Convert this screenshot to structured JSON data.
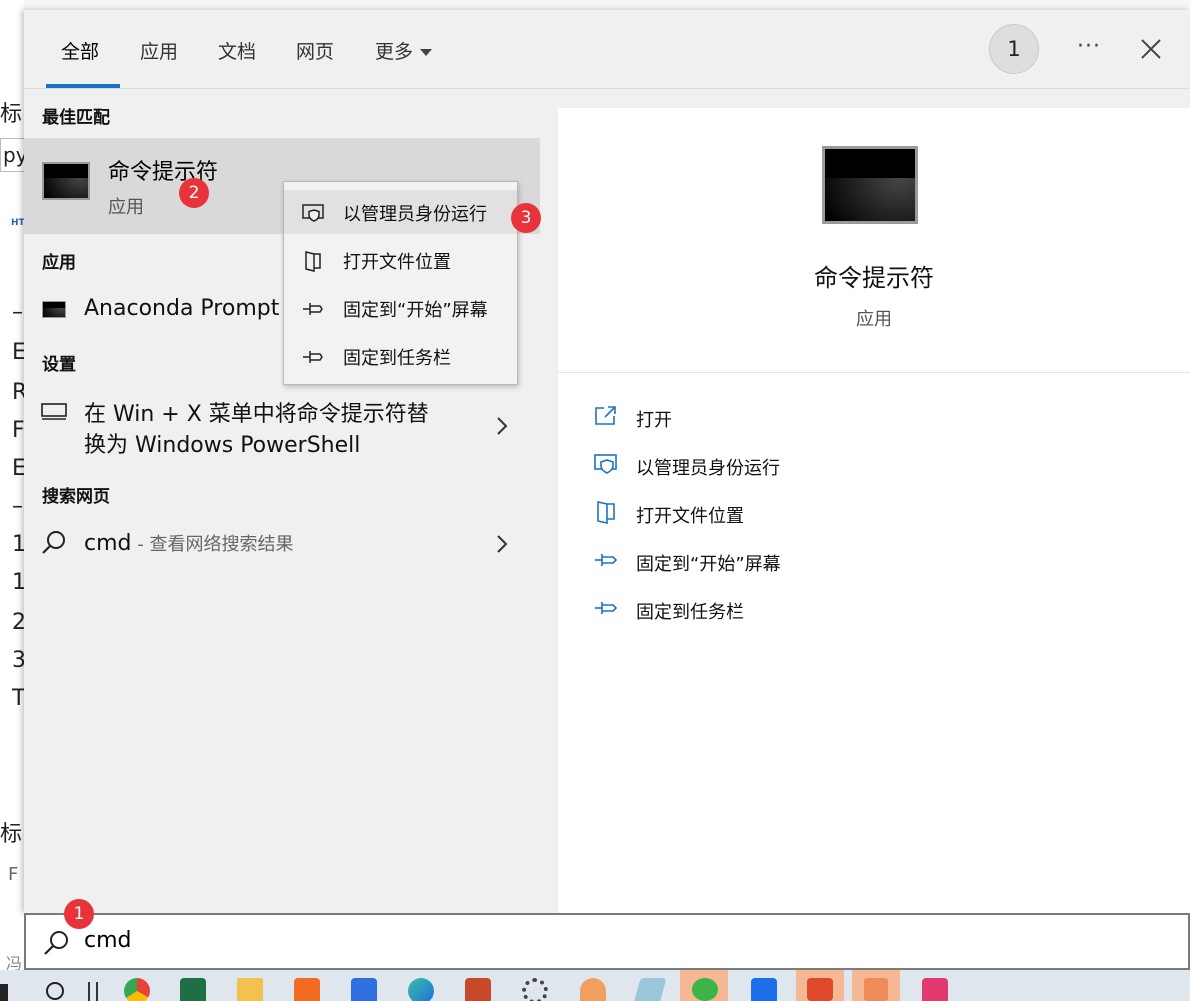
{
  "background_page": {
    "fragments": [
      "标",
      "py",
      "HT",
      "–",
      "E",
      "R",
      "F",
      "E",
      "–",
      "1",
      "1",
      "2",
      "3",
      "T",
      "标",
      "F",
      "冯"
    ]
  },
  "tabs": [
    {
      "label": "全部",
      "active": true
    },
    {
      "label": "应用",
      "active": false
    },
    {
      "label": "文档",
      "active": false
    },
    {
      "label": "网页",
      "active": false
    },
    {
      "label": "更多",
      "active": false
    }
  ],
  "header": {
    "avatar_text": "1",
    "more_icon": "ellipsis-icon",
    "close_icon": "close-icon"
  },
  "results": {
    "best_match_header": "最佳匹配",
    "best_match": {
      "title": "命令提示符",
      "subtitle": "应用",
      "icon": "command-prompt-icon"
    },
    "apps_header": "应用",
    "apps": [
      {
        "label": "Anaconda Prompt",
        "icon": "command-prompt-icon"
      }
    ],
    "settings_header": "设置",
    "settings": [
      {
        "line1": "在 Win + X 菜单中将命令提示符替",
        "line2": "换为 Windows PowerShell",
        "icon": "monitor-icon"
      }
    ],
    "web_header": "搜索网页",
    "web": [
      {
        "query": "cmd",
        "suffix": " - 查看网络搜索结果",
        "icon": "search-icon"
      }
    ]
  },
  "context_menu": {
    "items": [
      {
        "label": "以管理员身份运行",
        "icon": "shield-icon",
        "highlighted": true
      },
      {
        "label": "打开文件位置",
        "icon": "file-location-icon",
        "highlighted": false
      },
      {
        "label": "固定到“开始”屏幕",
        "icon": "pin-icon",
        "highlighted": false
      },
      {
        "label": "固定到任务栏",
        "icon": "pin-icon",
        "highlighted": false
      }
    ]
  },
  "preview": {
    "title": "命令提示符",
    "subtitle": "应用",
    "icon": "command-prompt-icon",
    "actions": [
      {
        "label": "打开",
        "icon": "open-icon"
      },
      {
        "label": "以管理员身份运行",
        "icon": "shield-icon"
      },
      {
        "label": "打开文件位置",
        "icon": "file-location-icon"
      },
      {
        "label": "固定到“开始”屏幕",
        "icon": "pin-icon"
      },
      {
        "label": "固定到任务栏",
        "icon": "pin-icon"
      }
    ]
  },
  "search": {
    "value": "cmd",
    "icon": "search-icon"
  },
  "annotations": [
    "1",
    "2",
    "3"
  ],
  "colors": {
    "accent": "#1a73c8",
    "badge": "#e8333a",
    "highlight": "#d9d9d9"
  },
  "taskbar": {
    "icons": [
      "windows-start-icon",
      "search-icon",
      "task-view-icon",
      "chrome-icon",
      "excel-icon",
      "file-explorer-icon",
      "sogou-icon",
      "tencent-meeting-icon",
      "edge-icon",
      "powerpoint-icon",
      "settings-icon",
      "fox-app-icon",
      "eraser-app-icon",
      "wechat-icon",
      "feishu-icon",
      "wps-icon",
      "volume-icon",
      "pdf-app-icon"
    ]
  }
}
